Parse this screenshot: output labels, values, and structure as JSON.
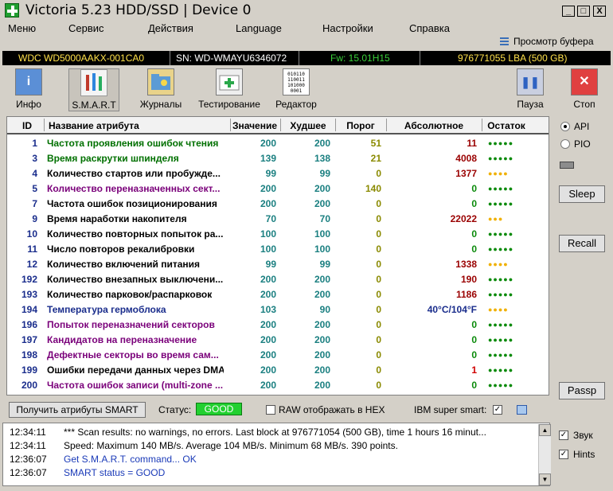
{
  "window": {
    "title": "Victoria 5.23 HDD/SSD | Device 0",
    "controls": [
      "_",
      "□",
      "X"
    ]
  },
  "menu": [
    "Меню",
    "Сервис",
    "Действия",
    "Language",
    "Настройки",
    "Справка"
  ],
  "buffer_link": "Просмотр буфера",
  "device": {
    "model": "WDC WD5000AAKX-001CA0",
    "serial": "SN: WD-WMAYU6346072",
    "firmware": "Fw: 15.01H15",
    "capacity": "976771055 LBA (500 GB)"
  },
  "toolbar": {
    "info": "Инфо",
    "smart": "S.M.A.R.T",
    "logs": "Журналы",
    "test": "Тестирование",
    "editor": "Редактор",
    "pause": "Пауза",
    "stop": "Стоп"
  },
  "table": {
    "headers": [
      "ID",
      "Название атрибута",
      "Значение",
      "Худшее",
      "Порог",
      "Абсолютное",
      "Остаток"
    ],
    "rows": [
      {
        "id": "1",
        "name": "Частота проявления ошибок чтения",
        "value": "200",
        "worst": "200",
        "threshold": "51",
        "raw": "11",
        "dots": "●●●●●",
        "name_color": "#007000",
        "raw_color": "#9a0000",
        "dots_color": "#0a8a0a"
      },
      {
        "id": "3",
        "name": "Время раскрутки шпинделя",
        "value": "139",
        "worst": "138",
        "threshold": "21",
        "raw": "4008",
        "dots": "●●●●●",
        "name_color": "#007000",
        "raw_color": "#9a0000",
        "dots_color": "#0a8a0a"
      },
      {
        "id": "4",
        "name": "Количество стартов или пробужде...",
        "value": "99",
        "worst": "99",
        "threshold": "0",
        "raw": "1377",
        "dots": "●●●●",
        "name_color": "#000000",
        "raw_color": "#9a0000",
        "dots_color": "#f0b000"
      },
      {
        "id": "5",
        "name": "Количество переназначенных сект...",
        "value": "200",
        "worst": "200",
        "threshold": "140",
        "raw": "0",
        "dots": "●●●●●",
        "name_color": "#7a007a",
        "raw_color": "#0a8a0a",
        "dots_color": "#0a8a0a"
      },
      {
        "id": "7",
        "name": "Частота ошибок позиционирования",
        "value": "200",
        "worst": "200",
        "threshold": "0",
        "raw": "0",
        "dots": "●●●●●",
        "name_color": "#000000",
        "raw_color": "#0a8a0a",
        "dots_color": "#0a8a0a"
      },
      {
        "id": "9",
        "name": "Время наработки накопителя",
        "value": "70",
        "worst": "70",
        "threshold": "0",
        "raw": "22022",
        "dots": "●●●",
        "name_color": "#000000",
        "raw_color": "#9a0000",
        "dots_color": "#f0b000"
      },
      {
        "id": "10",
        "name": "Количество повторных попыток ра...",
        "value": "100",
        "worst": "100",
        "threshold": "0",
        "raw": "0",
        "dots": "●●●●●",
        "name_color": "#000000",
        "raw_color": "#0a8a0a",
        "dots_color": "#0a8a0a"
      },
      {
        "id": "11",
        "name": "Число повторов рекалибровки",
        "value": "100",
        "worst": "100",
        "threshold": "0",
        "raw": "0",
        "dots": "●●●●●",
        "name_color": "#000000",
        "raw_color": "#0a8a0a",
        "dots_color": "#0a8a0a"
      },
      {
        "id": "12",
        "name": "Количество включений питания",
        "value": "99",
        "worst": "99",
        "threshold": "0",
        "raw": "1338",
        "dots": "●●●●",
        "name_color": "#000000",
        "raw_color": "#9a0000",
        "dots_color": "#f0b000"
      },
      {
        "id": "192",
        "name": "Количество внезапных выключени...",
        "value": "200",
        "worst": "200",
        "threshold": "0",
        "raw": "190",
        "dots": "●●●●●",
        "name_color": "#000000",
        "raw_color": "#9a0000",
        "dots_color": "#0a8a0a"
      },
      {
        "id": "193",
        "name": "Количество парковок/распарковок",
        "value": "200",
        "worst": "200",
        "threshold": "0",
        "raw": "1186",
        "dots": "●●●●●",
        "name_color": "#000000",
        "raw_color": "#9a0000",
        "dots_color": "#0a8a0a"
      },
      {
        "id": "194",
        "name": "Температура гермоблока",
        "value": "103",
        "worst": "90",
        "threshold": "0",
        "raw": "40°C/104°F",
        "dots": "●●●●",
        "name_color": "#1a2d8c",
        "raw_color": "#1a2d8c",
        "dots_color": "#f0b000"
      },
      {
        "id": "196",
        "name": "Попыток переназначений секторов",
        "value": "200",
        "worst": "200",
        "threshold": "0",
        "raw": "0",
        "dots": "●●●●●",
        "name_color": "#7a007a",
        "raw_color": "#0a8a0a",
        "dots_color": "#0a8a0a"
      },
      {
        "id": "197",
        "name": "Кандидатов на переназначение",
        "value": "200",
        "worst": "200",
        "threshold": "0",
        "raw": "0",
        "dots": "●●●●●",
        "name_color": "#7a007a",
        "raw_color": "#0a8a0a",
        "dots_color": "#0a8a0a"
      },
      {
        "id": "198",
        "name": "Дефектные секторы во время сам...",
        "value": "200",
        "worst": "200",
        "threshold": "0",
        "raw": "0",
        "dots": "●●●●●",
        "name_color": "#7a007a",
        "raw_color": "#0a8a0a",
        "dots_color": "#0a8a0a"
      },
      {
        "id": "199",
        "name": "Ошибки передачи данных через DMA",
        "value": "200",
        "worst": "200",
        "threshold": "0",
        "raw": "1",
        "dots": "●●●●●",
        "name_color": "#000000",
        "raw_color": "#d00000",
        "dots_color": "#0a8a0a"
      },
      {
        "id": "200",
        "name": "Частота ошибок записи (multi-zone ...",
        "value": "200",
        "worst": "200",
        "threshold": "0",
        "raw": "0",
        "dots": "●●●●●",
        "name_color": "#7a007a",
        "raw_color": "#0a8a0a",
        "dots_color": "#0a8a0a"
      }
    ]
  },
  "side": {
    "api": "API",
    "pio": "PIO",
    "sleep": "Sleep",
    "recall": "Recall",
    "passp": "Passp",
    "sound": "Звук",
    "hints": "Hints"
  },
  "status": {
    "get_button": "Получить атрибуты SMART",
    "label": "Статус:",
    "value": "GOOD",
    "raw_hex": "RAW отображать в HEX",
    "ibm": "IBM super smart:"
  },
  "log": [
    {
      "time": "12:34:11",
      "text": "*** Scan results: no warnings, no errors. Last block at 976771054 (500 GB), time 1 hours 16 minut...",
      "color": "#000000"
    },
    {
      "time": "12:34:11",
      "text": "Speed: Maximum 140 MB/s. Average 104 MB/s. Minimum 68 MB/s. 390 points.",
      "color": "#000000"
    },
    {
      "time": "12:36:07",
      "text": "Get S.M.A.R.T. command... OK",
      "color": "#1a3ab8"
    },
    {
      "time": "12:36:07",
      "text": "SMART status = GOOD",
      "color": "#1a3ab8"
    }
  ]
}
